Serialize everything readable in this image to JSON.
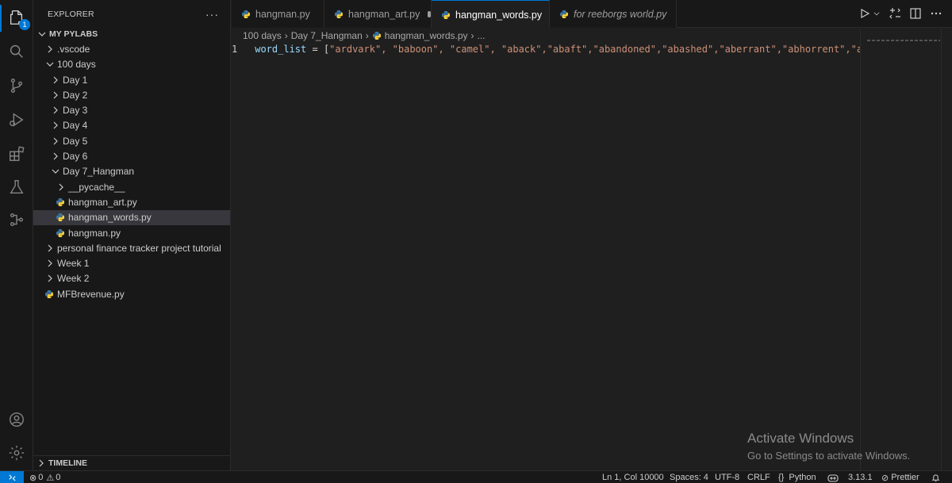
{
  "activity_bar": {
    "explorer_badge": "1",
    "icons": [
      "files-icon",
      "search-icon",
      "source-control-icon",
      "run-debug-icon",
      "extensions-icon",
      "testing-icon",
      "remote-explorer-icon",
      "account-icon",
      "settings-gear-icon"
    ]
  },
  "sidebar": {
    "title": "EXPLORER",
    "more": "···",
    "section": "MY PYLABS",
    "items": [
      {
        "label": ".vscode",
        "type": "folder",
        "expanded": false,
        "depth": 1
      },
      {
        "label": "100 days",
        "type": "folder",
        "expanded": true,
        "depth": 1
      },
      {
        "label": "Day 1",
        "type": "folder",
        "expanded": false,
        "depth": 2
      },
      {
        "label": "Day 2",
        "type": "folder",
        "expanded": false,
        "depth": 2
      },
      {
        "label": "Day 3",
        "type": "folder",
        "expanded": false,
        "depth": 2
      },
      {
        "label": "Day 4",
        "type": "folder",
        "expanded": false,
        "depth": 2
      },
      {
        "label": "Day 5",
        "type": "folder",
        "expanded": false,
        "depth": 2
      },
      {
        "label": "Day 6",
        "type": "folder",
        "expanded": false,
        "depth": 2
      },
      {
        "label": "Day 7_Hangman",
        "type": "folder",
        "expanded": true,
        "depth": 2
      },
      {
        "label": "__pycache__",
        "type": "folder",
        "expanded": false,
        "depth": 3
      },
      {
        "label": "hangman_art.py",
        "type": "file",
        "depth": 3
      },
      {
        "label": "hangman_words.py",
        "type": "file",
        "depth": 3,
        "selected": true
      },
      {
        "label": "hangman.py",
        "type": "file",
        "depth": 3
      },
      {
        "label": "personal finance tracker project tutorial",
        "type": "folder",
        "expanded": false,
        "depth": 1
      },
      {
        "label": "Week 1",
        "type": "folder",
        "expanded": false,
        "depth": 1
      },
      {
        "label": "Week 2",
        "type": "folder",
        "expanded": false,
        "depth": 1
      },
      {
        "label": "MFBrevenue.py",
        "type": "file",
        "depth": 1
      }
    ],
    "timeline": "TIMELINE"
  },
  "tabs": [
    {
      "label": "hangman.py",
      "state": "normal"
    },
    {
      "label": "hangman_art.py",
      "state": "modified"
    },
    {
      "label": "hangman_words.py",
      "state": "active"
    },
    {
      "label": "for reeborgs world.py",
      "state": "preview"
    }
  ],
  "breadcrumb": {
    "parts": [
      "100 days",
      "Day 7_Hangman",
      "hangman_words.py",
      "..."
    ]
  },
  "editor": {
    "line_number": "1",
    "code_ident": "word_list",
    "code_op": " = [",
    "code_rest": "\"ardvark\", \"baboon\", \"camel\", \"aback\",\"abaft\",\"abandoned\",\"abashed\",\"aberrant\",\"abhorrent\",\"abid"
  },
  "watermark": {
    "line1": "Activate Windows",
    "line2": "Go to Settings to activate Windows."
  },
  "status_bar": {
    "errors": "0",
    "warnings": "0",
    "position": "Ln 1, Col 10000",
    "spaces": "Spaces: 4",
    "encoding": "UTF-8",
    "eol": "CRLF",
    "language": "Python",
    "braces": "{}",
    "python_version": "3.13.1",
    "prettier": "Prettier"
  },
  "colors": {
    "accent": "#0078d4",
    "background": "#1f1f1f",
    "sidebar": "#181818",
    "selection": "#37373d"
  }
}
